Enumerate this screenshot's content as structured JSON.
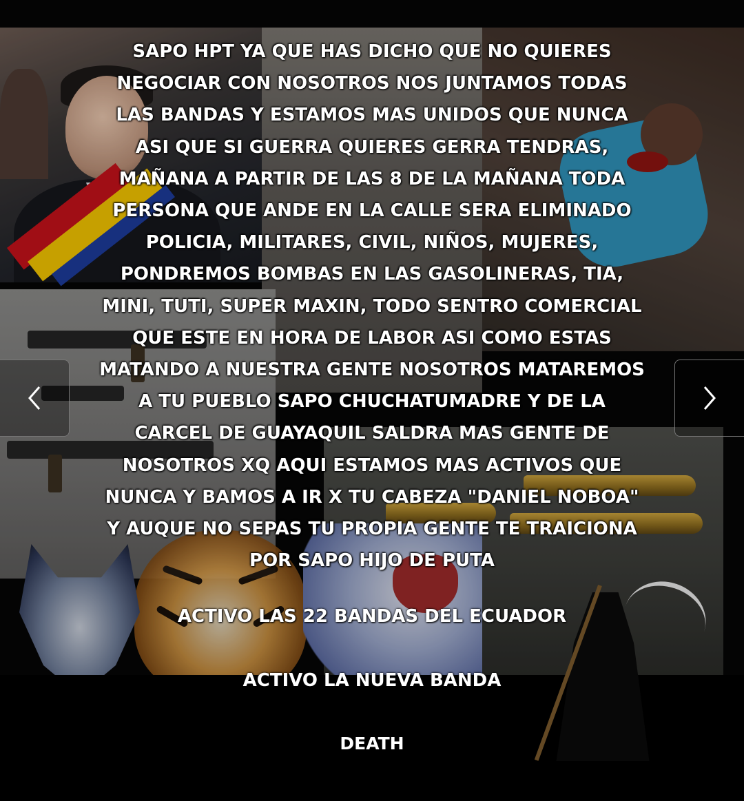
{
  "message": {
    "lines": [
      "SAPO HPT YA QUE HAS DICHO QUE NO QUIERES",
      "NEGOCIAR CON NOSOTROS NOS JUNTAMOS TODAS",
      "LAS BANDAS Y ESTAMOS MAS UNIDOS QUE NUNCA",
      "ASI QUE SI GUERRA QUIERES GERRA TENDRAS,",
      "MAÑANA A PARTIR DE LAS 8 DE LA MAÑANA TODA",
      "PERSONA QUE ANDE EN LA CALLE SERA ELIMINADO",
      "POLICIA, MILITARES, CIVIL, NIÑOS, MUJERES,",
      "PONDREMOS BOMBAS EN LAS GASOLINERAS, TIA,",
      "MINI, TUTI, SUPER MAXIN, TODO SENTRO COMERCIAL",
      "QUE ESTE EN HORA DE LABOR ASI COMO ESTAS",
      "MATANDO A NUESTRA GENTE NOSOTROS MATAREMOS",
      "A TU PUEBLO SAPO CHUCHATUMADRE Y DE LA",
      "CARCEL DE GUAYAQUIL SALDRA MAS GENTE DE",
      "NOSOTROS XQ AQUI ESTAMOS MAS ACTIVOS QUE",
      "NUNCA Y BAMOS A IR X TU CABEZA \"DANIEL NOBOA\"",
      "Y AUQUE NO SEPAS TU PROPIA GENTE TE TRAICIONA",
      "POR SAPO HIJO DE PUTA"
    ]
  },
  "signoff": {
    "line1": "ACTIVO LAS 22 BANDAS DEL ECUADOR",
    "line2": "ACTIVO LA NUEVA BANDA",
    "line3": "DEATH"
  },
  "navigation": {
    "prev_icon": "chevron-left-icon",
    "next_icon": "chevron-right-icon"
  },
  "colors": {
    "background": "#000000",
    "text": "#ffffff"
  }
}
